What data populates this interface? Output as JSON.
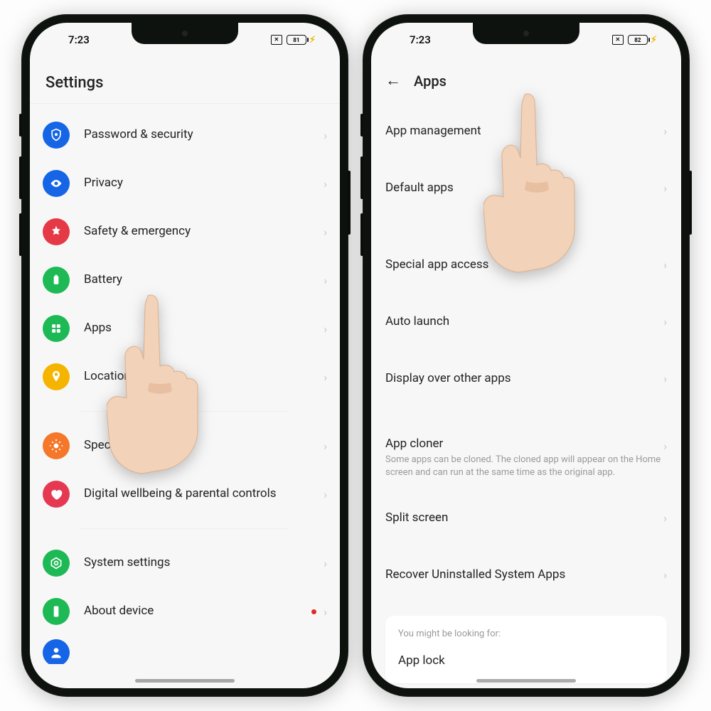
{
  "left": {
    "time": "7:23",
    "battery_pct": "81",
    "header": "Settings",
    "rows": [
      {
        "label": "Password & security"
      },
      {
        "label": "Privacy"
      },
      {
        "label": "Safety & emergency"
      },
      {
        "label": "Battery"
      },
      {
        "label": "Apps"
      },
      {
        "label": "Location"
      },
      {
        "label": "Special"
      },
      {
        "label": "Digital wellbeing & parental controls"
      },
      {
        "label": "System settings"
      },
      {
        "label": "About device"
      }
    ]
  },
  "right": {
    "time": "7:23",
    "battery_pct": "82",
    "header": "Apps",
    "rows": [
      {
        "label": "App management"
      },
      {
        "label": "Default apps"
      },
      {
        "label": "Special app access"
      },
      {
        "label": "Auto launch"
      },
      {
        "label": "Display over other apps"
      },
      {
        "label": "App cloner",
        "sub": "Some apps can be cloned. The cloned app will appear on the Home screen and can run at the same time as the original app."
      },
      {
        "label": "Split screen"
      },
      {
        "label": "Recover Uninstalled System Apps"
      }
    ],
    "suggest_title": "You might be looking for:",
    "suggest_item": "App lock"
  }
}
